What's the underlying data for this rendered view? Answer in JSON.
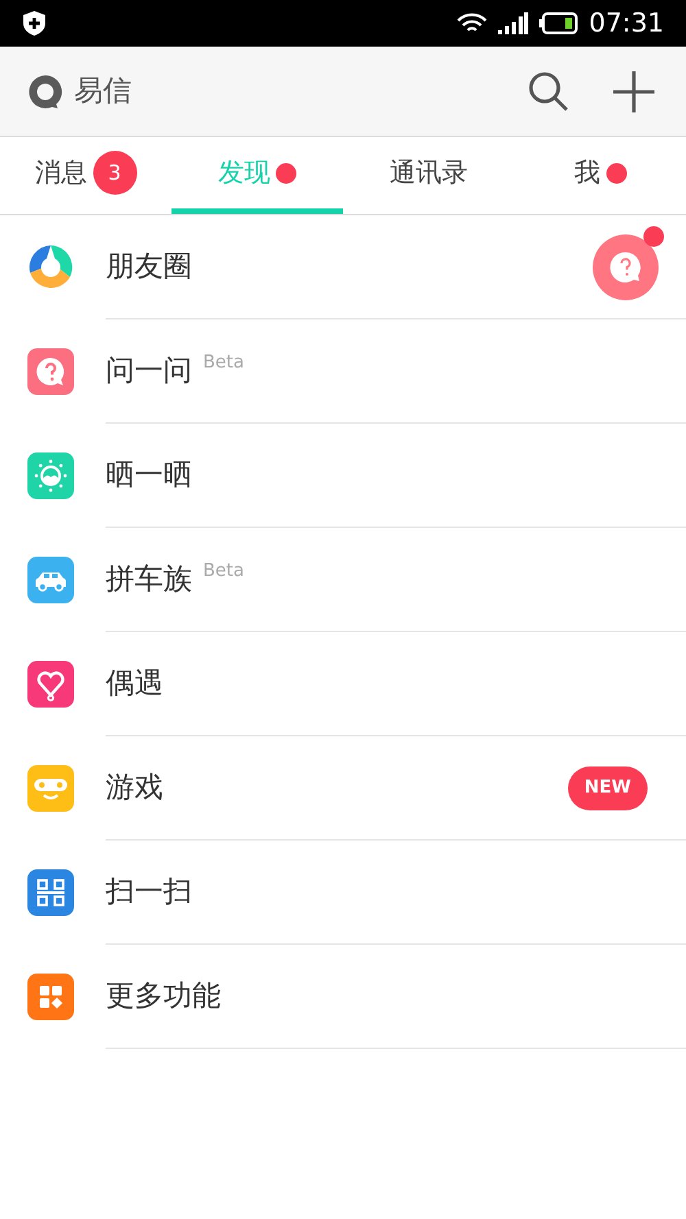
{
  "status_bar": {
    "time": "07:31"
  },
  "header": {
    "title": "易信"
  },
  "tabs": [
    {
      "label": "消息",
      "selected": false,
      "badge": "3",
      "dot": false
    },
    {
      "label": "发现",
      "selected": true,
      "dot": true
    },
    {
      "label": "通讯录",
      "selected": false,
      "dot": false
    },
    {
      "label": "我",
      "selected": false,
      "dot": true
    }
  ],
  "items": [
    {
      "kind": "moments",
      "label": "朋友圈",
      "color": "#2b7de0",
      "avatar_dot": true
    },
    {
      "kind": "ask",
      "label": "问一问",
      "color": "#fb6f80",
      "tag": "Beta"
    },
    {
      "kind": "sun",
      "label": "晒一晒",
      "color": "#1fd4a6"
    },
    {
      "kind": "car",
      "label": "拼车族",
      "color": "#3bb2ef",
      "tag": "Beta"
    },
    {
      "kind": "heart",
      "label": "偶遇",
      "color": "#f7397a"
    },
    {
      "kind": "game",
      "label": "游戏",
      "color": "#ffbe16",
      "badge": "NEW"
    },
    {
      "kind": "scan",
      "label": "扫一扫",
      "color": "#2a86e0"
    },
    {
      "kind": "more",
      "label": "更多功能",
      "color": "#ff7414"
    }
  ]
}
